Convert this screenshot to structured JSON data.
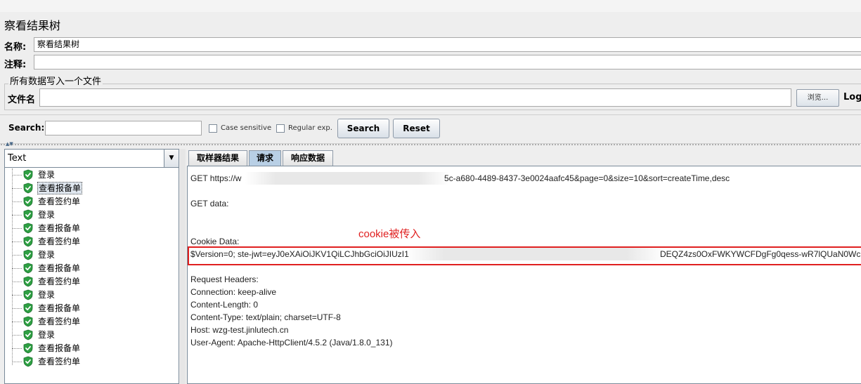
{
  "window": {
    "title": "察看结果树"
  },
  "form": {
    "name_label": "名称:",
    "name_value": "察看结果树",
    "comment_label": "注释:",
    "comment_value": "",
    "file_group_title": "所有数据写入一个文件",
    "filename_label": "文件名",
    "filename_value": "",
    "browse_label": "浏览...",
    "log_label": "Log/"
  },
  "search": {
    "label": "Search:",
    "value": "",
    "case_sensitive_label": "Case sensitive",
    "regex_label": "Regular exp.",
    "search_button": "Search",
    "reset_button": "Reset"
  },
  "renderer": {
    "selected": "Text"
  },
  "tree": {
    "items": [
      "登录",
      "查看报备单",
      "查看签约单",
      "登录",
      "查看报备单",
      "查看签约单",
      "登录",
      "查看报备单",
      "查看签约单",
      "登录",
      "查看报备单",
      "查看签约单",
      "登录",
      "查看报备单",
      "查看签约单"
    ],
    "selected_index": 1
  },
  "tabs": [
    "取样器结果",
    "请求",
    "响应数据"
  ],
  "active_tab_index": 1,
  "request": {
    "line_get": "GET https://w",
    "line_get_tail": "5c-a680-4489-8437-3e0024aafc45&page=0&size=10&sort=createTime,desc",
    "get_data": "GET data:",
    "cookie_label": "Cookie Data:",
    "cookie_value": "$Version=0; ste-jwt=eyJ0eXAiOiJKV1QiLCJhbGciOiJIUzI1",
    "cookie_tail": "DEQZ4zs0OxFWKYWCFDgFg0qess-wR7lQUaN0Wc",
    "headers_label": "Request Headers:",
    "headers": [
      "Connection: keep-alive",
      "Content-Length: 0",
      "Content-Type: text/plain; charset=UTF-8",
      "Host: wzg-test.jinlutech.cn",
      "User-Agent: Apache-HttpClient/4.5.2 (Java/1.8.0_131)"
    ]
  },
  "annotation": "cookie被传入",
  "colors": {
    "highlight_red": "#e02020",
    "active_tab": "#b8cfe5",
    "check_green": "#2ea043"
  }
}
